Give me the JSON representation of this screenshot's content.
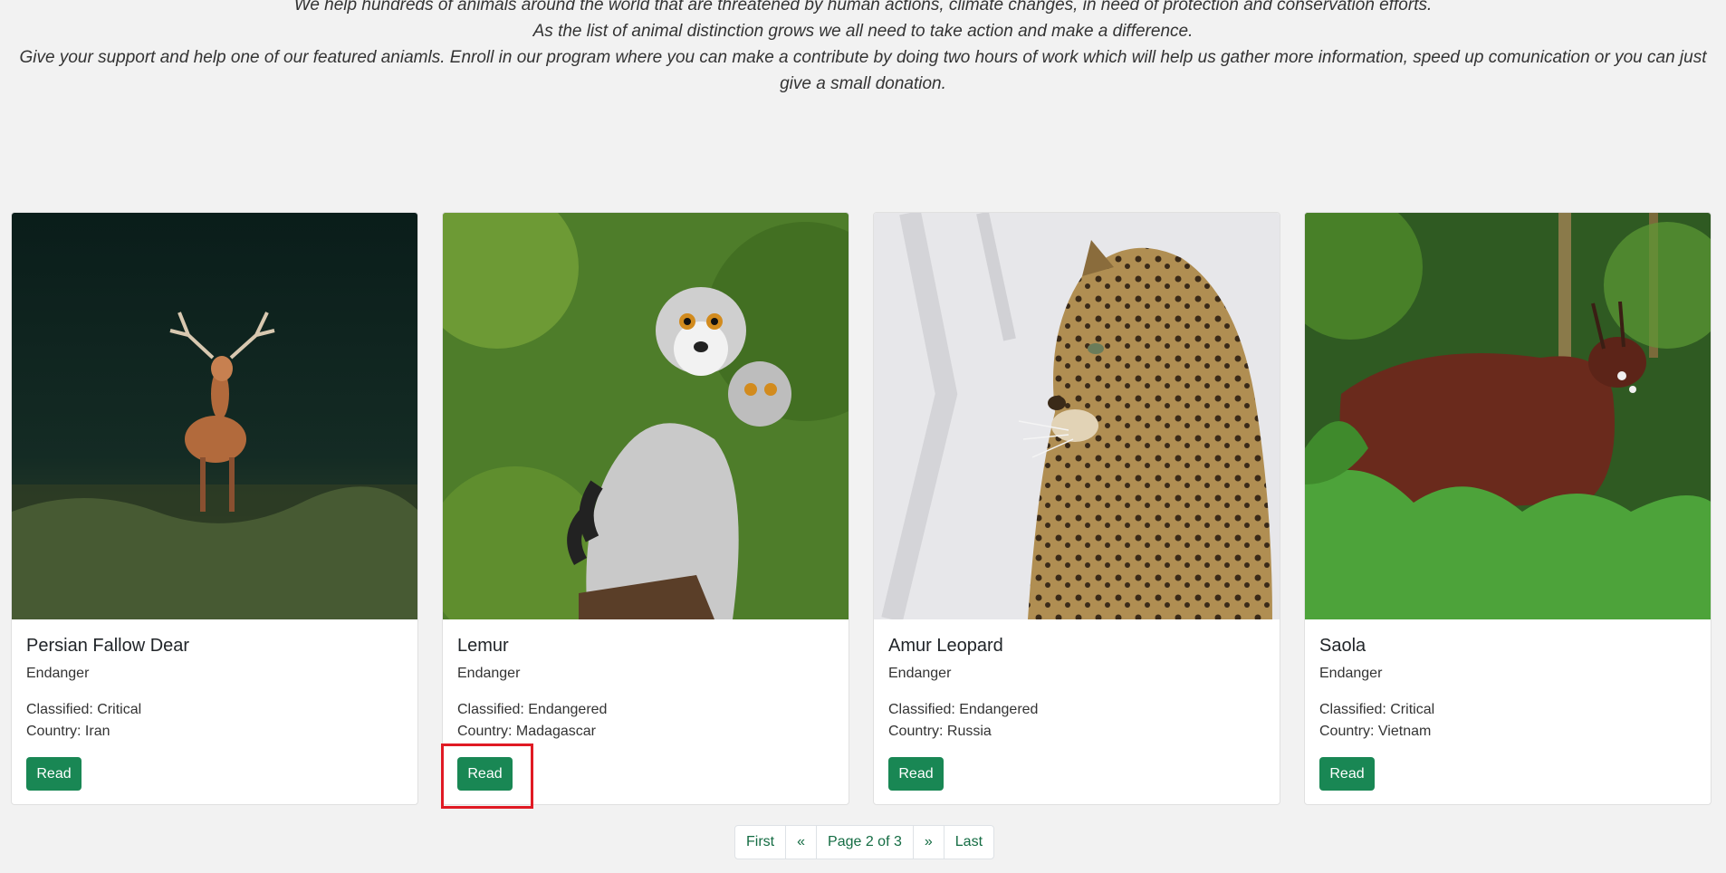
{
  "intro": {
    "line1": "We help hundreds of animals around the world that are threatened by human actions, climate changes, in need of protection and conservation efforts.",
    "line2": "As the list of animal distinction grows we all need to take action and make a difference.",
    "line3": "Give your support and help one of our featured aniamls. Enroll in our program where you can make a contribute by doing two hours of work which will help us gather more information, speed up comunication or you can just give a small donation."
  },
  "cards": [
    {
      "title": "Persian Fallow Dear",
      "subtitle": "Endanger",
      "classified": "Classified: Critical",
      "country": "Country: Iran",
      "button": "Read"
    },
    {
      "title": "Lemur",
      "subtitle": "Endanger",
      "classified": "Classified: Endangered",
      "country": "Country: Madagascar",
      "button": "Read"
    },
    {
      "title": "Amur Leopard",
      "subtitle": "Endanger",
      "classified": "Classified: Endangered",
      "country": "Country: Russia",
      "button": "Read"
    },
    {
      "title": "Saola",
      "subtitle": "Endanger",
      "classified": "Classified: Critical",
      "country": "Country: Vietnam",
      "button": "Read"
    }
  ],
  "pagination": {
    "first": "First",
    "prev": "«",
    "info": "Page 2 of 3",
    "next": "»",
    "last": "Last"
  },
  "colors": {
    "accent": "#198754",
    "highlight": "#e01a24",
    "background": "#f2f2f2"
  }
}
